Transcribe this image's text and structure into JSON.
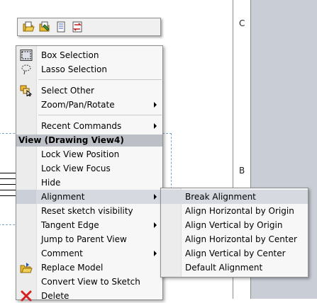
{
  "background": {
    "zone_letters": [
      "C",
      "B"
    ]
  },
  "toolbar": {
    "buttons": [
      {
        "icon": "open-drawing-icon"
      },
      {
        "icon": "edit-sheet-icon"
      },
      {
        "icon": "layers-icon"
      },
      {
        "icon": "swap-icon"
      }
    ]
  },
  "context_menu": {
    "items": [
      {
        "label": "Box Selection",
        "icon": "box-selection-icon"
      },
      {
        "label": "Lasso Selection",
        "icon": "lasso-icon"
      },
      {
        "label": "Select Other",
        "icon": "select-other-icon"
      },
      {
        "label": "Zoom/Pan/Rotate",
        "icon": ""
      },
      {
        "label": "Recent Commands",
        "icon": ""
      },
      {
        "label": "Lock View Position",
        "icon": ""
      },
      {
        "label": "Lock View Focus",
        "icon": ""
      },
      {
        "label": "Hide",
        "icon": ""
      },
      {
        "label": "Alignment",
        "icon": ""
      },
      {
        "label": "Reset sketch visibility",
        "icon": ""
      },
      {
        "label": "Tangent Edge",
        "icon": ""
      },
      {
        "label": "Jump to Parent View",
        "icon": ""
      },
      {
        "label": "Comment",
        "icon": ""
      },
      {
        "label": "Replace Model",
        "icon": "replace-model-icon"
      },
      {
        "label": "Convert View to Sketch",
        "icon": ""
      },
      {
        "label": "Delete",
        "icon": "delete-icon"
      }
    ],
    "section_header": "View (Drawing View4)"
  },
  "alignment_submenu": {
    "items": [
      {
        "label": "Break Alignment"
      },
      {
        "label": "Align Horizontal by Origin"
      },
      {
        "label": "Align Vertical by Origin"
      },
      {
        "label": "Align Horizontal by Center"
      },
      {
        "label": "Align Vertical by Center"
      },
      {
        "label": "Default Alignment"
      }
    ]
  },
  "colors": {
    "menu_bg": "#f7f7f7",
    "highlight": "#d6dae0",
    "header_bg": "#bcc0c6",
    "delete_red": "#d42020"
  }
}
